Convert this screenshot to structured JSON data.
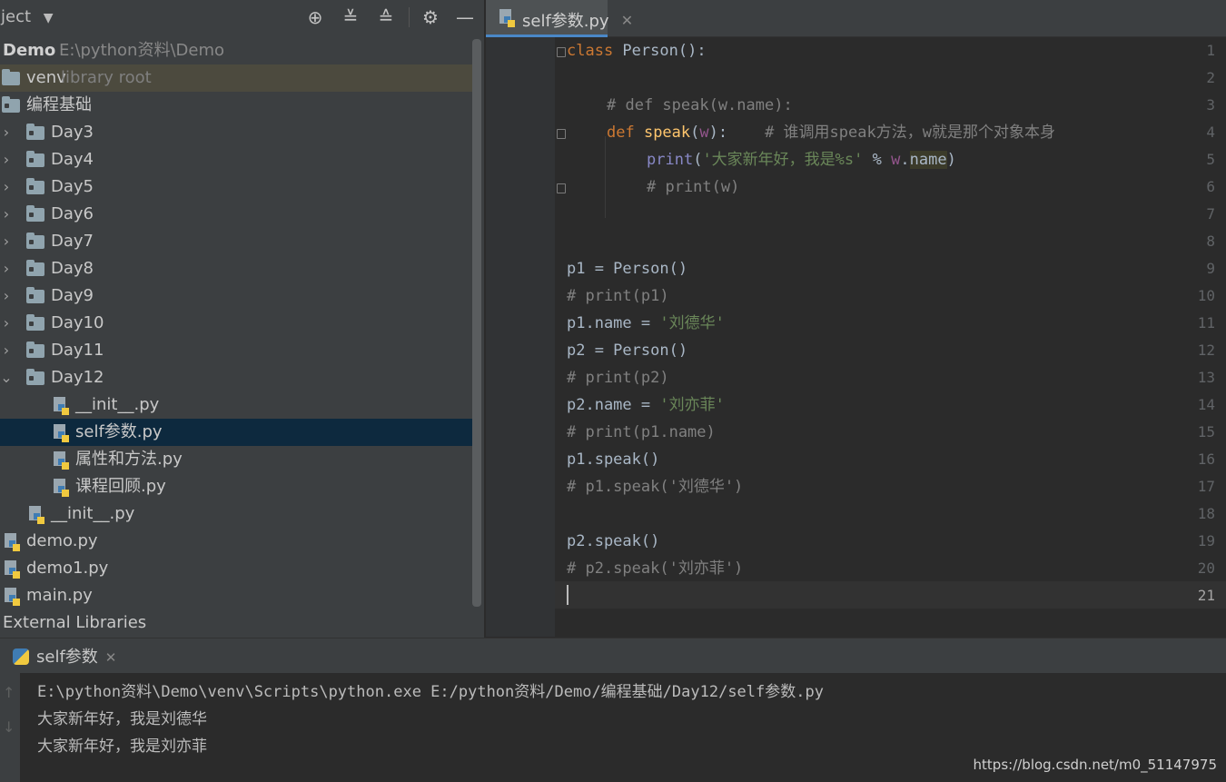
{
  "project": {
    "title": "oject",
    "root_name": "Demo",
    "root_path": "E:\\python资料\\Demo",
    "venv": {
      "label": "venv",
      "suffix": "library root"
    },
    "folder_main": "编程基础",
    "days": [
      "Day3",
      "Day4",
      "Day5",
      "Day6",
      "Day7",
      "Day8",
      "Day9",
      "Day10",
      "Day11"
    ],
    "day12": "Day12",
    "day12_files": [
      "__init__.py",
      "self参数.py",
      "属性和方法.py",
      "课程回顾.py"
    ],
    "init_file": "__init__.py",
    "root_files": [
      "demo.py",
      "demo1.py",
      "main.py"
    ],
    "external": "External Libraries"
  },
  "editor": {
    "tab_label": "self参数.py",
    "line_numbers": [
      "1",
      "2",
      "3",
      "4",
      "5",
      "6",
      "7",
      "8",
      "9",
      "10",
      "11",
      "12",
      "13",
      "14",
      "15",
      "16",
      "17",
      "18",
      "19",
      "20",
      "21"
    ],
    "code": {
      "l1_kw": "class",
      "l1_name": " Person",
      "l1_rest": "():",
      "l3": "# def speak(w.name):",
      "l4_kw": "def",
      "l4_fn": " speak",
      "l4_open": "(",
      "l4_param": "w",
      "l4_close": "):",
      "l4_comment": "    # 谁调用speak方法，w就是那个对象本身",
      "l5_fn": "print",
      "l5_open": "(",
      "l5_str": "'大家新年好，我是%s'",
      "l5_op": " % ",
      "l5_w": "w",
      "l5_dot": ".",
      "l5_name": "name",
      "l5_close": ")",
      "l6": "# print(w)",
      "l9": "p1 = Person()",
      "l10": "# print(p1)",
      "l11_a": "p1.name = ",
      "l11_s": "'刘德华'",
      "l12": "p2 = Person()",
      "l13": "# print(p2)",
      "l14_a": "p2.name = ",
      "l14_s": "'刘亦菲'",
      "l15": "# print(p1.name)",
      "l16": "p1.speak()",
      "l17": "# p1.speak('刘德华')",
      "l19": "p2.speak()",
      "l20": "# p2.speak('刘亦菲')"
    }
  },
  "run": {
    "tab_label": "self参数",
    "output": [
      "E:\\python资料\\Demo\\venv\\Scripts\\python.exe E:/python资料/Demo/编程基础/Day12/self参数.py",
      "大家新年好，我是刘德华",
      "大家新年好，我是刘亦菲"
    ]
  },
  "watermark": "https://blog.csdn.net/m0_51147975"
}
